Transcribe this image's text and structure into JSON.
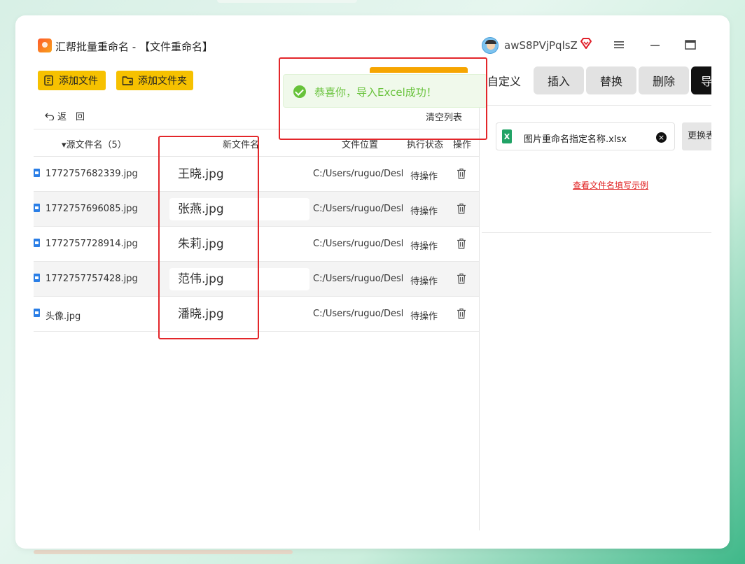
{
  "app": {
    "title": "汇帮批量重命名 - 【文件重命名】",
    "username": "awS8PVjPqlsZ"
  },
  "toolbar": {
    "add_file_label": "添加文件",
    "add_folder_label": "添加文件夹",
    "back_label": "返　回",
    "clear_list_label": "清空列表"
  },
  "table": {
    "headers": {
      "source": "▾源文件名（5）",
      "new_name": "新文件名",
      "location": "文件位置",
      "status": "执行状态",
      "operation": "操作"
    },
    "rows": [
      {
        "source": "1772757682339.jpg",
        "new_name": "王晓.jpg",
        "location": "C:/Users/ruguo/Desktop",
        "status": "待操作"
      },
      {
        "source": "1772757696085.jpg",
        "new_name": "张燕.jpg",
        "location": "C:/Users/ruguo/Desktop",
        "status": "待操作"
      },
      {
        "source": "1772757728914.jpg",
        "new_name": "朱莉.jpg",
        "location": "C:/Users/ruguo/Desktop",
        "status": "待操作"
      },
      {
        "source": "1772757757428.jpg",
        "new_name": "范伟.jpg",
        "location": "C:/Users/ruguo/Desktop",
        "status": "待操作"
      },
      {
        "source": "头像.jpg",
        "new_name": "潘晓.jpg",
        "location": "C:/Users/ruguo/Desktop",
        "status": "待操作"
      }
    ]
  },
  "tabs": {
    "custom": "自定义",
    "insert": "插入",
    "replace": "替换",
    "delete": "删除",
    "dark_partial": "导"
  },
  "excel": {
    "file_name": "图片重命名指定名称.xlsx",
    "replace_button": "更换表格",
    "example_link": "查看文件名填写示例"
  },
  "toast": {
    "message": "恭喜你，导入Excel成功！"
  },
  "colors": {
    "accent_yellow": "#f6c100",
    "success_green": "#67c23a",
    "highlight_red": "#e3262a",
    "link_red": "#e02020"
  }
}
